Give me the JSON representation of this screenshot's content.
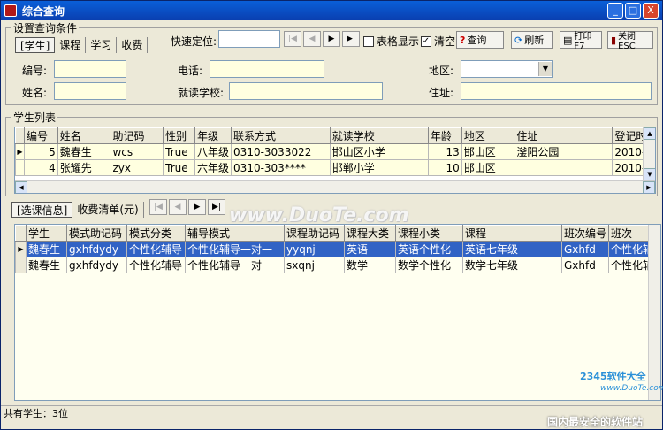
{
  "window": {
    "title": "综合查询",
    "min": "_",
    "max": "□",
    "close": "X"
  },
  "query": {
    "group_label": "设置查询条件",
    "tabs": [
      "[学生]",
      "课程",
      "学习",
      "收费"
    ],
    "quick_locate": "快速定位:",
    "table_show": "表格显示",
    "clear": "清空",
    "query_btn": "查询",
    "refresh_btn": "刷新",
    "print_btn": "打印F7",
    "close_btn": "关闭ESC",
    "fields": {
      "bianhao": "编号:",
      "xingming": "姓名:",
      "dianhua": "电话:",
      "xuexiao": "就读学校:",
      "diqu": "地区:",
      "zhuzhi": "住址:"
    }
  },
  "students": {
    "group_label": "学生列表",
    "columns": [
      "编号",
      "姓名",
      "助记码",
      "性别",
      "年级",
      "联系方式",
      "就读学校",
      "年龄",
      "地区",
      "住址",
      "登记时"
    ],
    "rows": [
      [
        "5",
        "魏春生",
        "wcs",
        "True",
        "八年级",
        "0310-3033022",
        "邯山区小学",
        "13",
        "邯山区",
        "滏阳公园",
        "2010-1"
      ],
      [
        "4",
        "张耀先",
        "zyx",
        "True",
        "六年级",
        "0310-303****",
        "邯郸小学",
        "10",
        "邯山区",
        "",
        "2010-1"
      ]
    ]
  },
  "lower": {
    "tabs": [
      "[选课信息]",
      "收费清单(元)"
    ],
    "columns": [
      "学生",
      "模式助记码",
      "模式分类",
      "辅导模式",
      "课程助记码",
      "课程大类",
      "课程小类",
      "课程",
      "班次编号",
      "班次"
    ],
    "rows": [
      [
        "魏春生",
        "gxhfdydy",
        "个性化辅导",
        "个性化辅导一对一",
        "yyqnj",
        "英语",
        "英语个性化",
        "英语七年级",
        "Gxhfd",
        "个性化辅"
      ],
      [
        "魏春生",
        "gxhfdydy",
        "个性化辅导",
        "个性化辅导一对一",
        "sxqnj",
        "数学",
        "数学个性化",
        "数学七年级",
        "Gxhfd",
        "个性化辅"
      ]
    ]
  },
  "status": {
    "text": "共有学生：3位"
  },
  "watermarks": {
    "main": "www.DuoTe.com",
    "logo": "2345软件大全",
    "logo_url": "www.DuoTe.com",
    "slogan": "国内最安全的软件站"
  },
  "nav": {
    "first": "|◀",
    "prev": "◀",
    "next": "▶",
    "last": "▶|"
  },
  "colors": {
    "title": "#0a3fb0",
    "selected": "#3163c5",
    "input_bg": "#ffffe0"
  }
}
